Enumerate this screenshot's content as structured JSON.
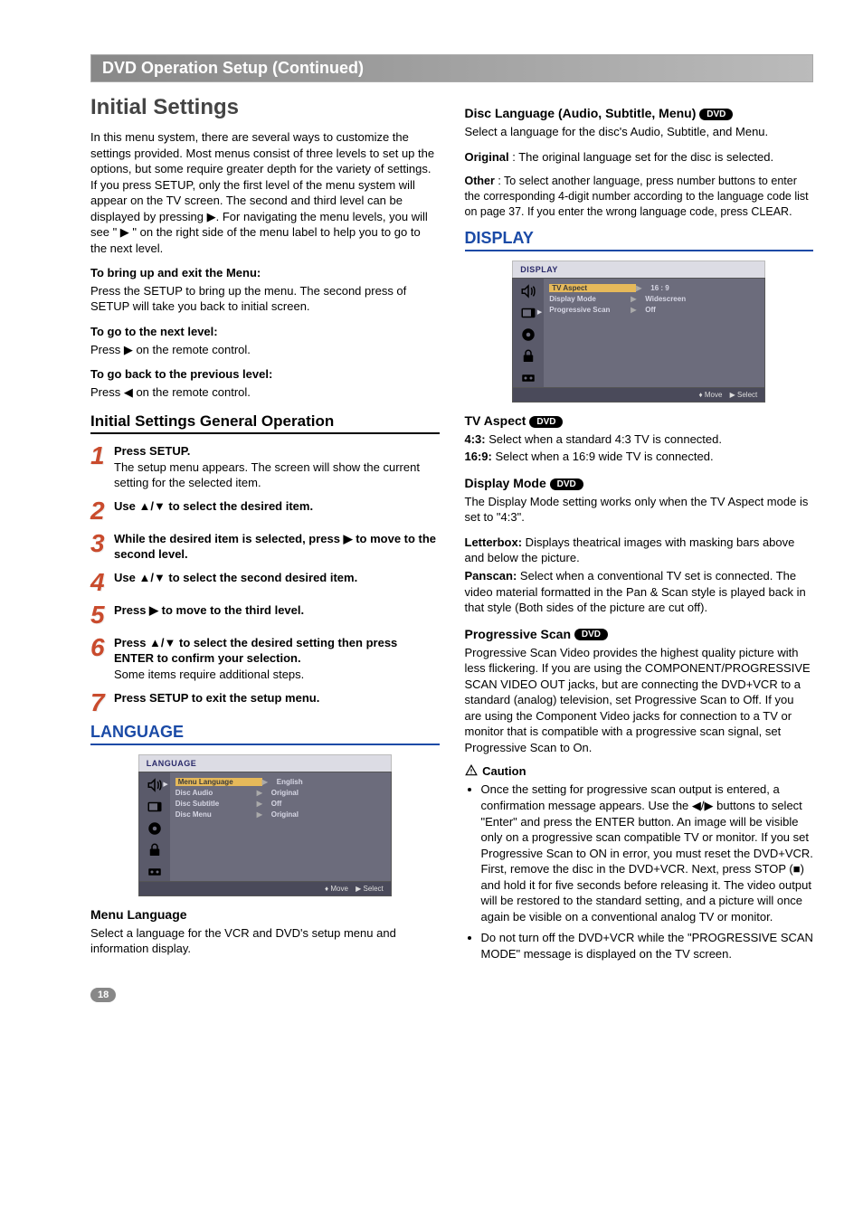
{
  "header": {
    "title": "DVD Operation Setup (Continued)"
  },
  "left": {
    "main_title": "Initial Settings",
    "intro": "In this menu system, there are several ways to customize the settings provided. Most menus consist of three levels to set up the options, but some require greater depth for the variety of settings. If you press SETUP, only the first level of the menu system will appear on the TV screen. The second and third level can be displayed by pressing ▶. For navigating the menu levels, you will see \" ▶ \" on the right side of the menu label to help you to go to the next level.",
    "bring_title": "To bring up and exit the Menu:",
    "bring_body": "Press the SETUP to bring up the menu. The second press of SETUP will take you back to initial screen.",
    "next_title": "To go to the next level:",
    "next_body": "Press ▶ on the remote control.",
    "prev_title": "To go back to the previous level:",
    "prev_body": "Press ◀ on the remote control.",
    "general_title": "Initial Settings General Operation",
    "steps": [
      {
        "n": "1",
        "bold": "Press SETUP.",
        "rest": "The setup menu appears. The screen will show the current setting for the selected item."
      },
      {
        "n": "2",
        "bold": "Use ▲/▼ to select the desired item.",
        "rest": ""
      },
      {
        "n": "3",
        "bold": "While the desired item is selected, press ▶ to move to the second level.",
        "rest": ""
      },
      {
        "n": "4",
        "bold": "Use ▲/▼ to select the second desired item.",
        "rest": ""
      },
      {
        "n": "5",
        "bold": "Press ▶ to move to the third level.",
        "rest": ""
      },
      {
        "n": "6",
        "bold": "Press ▲/▼ to select the desired setting then press ENTER to confirm your selection.",
        "rest": "Some items require additional steps."
      },
      {
        "n": "7",
        "bold": "Press SETUP to exit the setup menu.",
        "rest": ""
      }
    ],
    "language_heading": "LANGUAGE",
    "osd_lang": {
      "title": "LANGUAGE",
      "rows": [
        {
          "label": "Menu Language",
          "value": "English",
          "hl": true
        },
        {
          "label": "Disc Audio",
          "value": "Original",
          "hl": false
        },
        {
          "label": "Disc Subtitle",
          "value": "Off",
          "hl": false
        },
        {
          "label": "Disc Menu",
          "value": "Original",
          "hl": false
        }
      ],
      "footer_move": "Move",
      "footer_select": "Select"
    },
    "menu_lang_title": "Menu Language",
    "menu_lang_body": "Select a language for the VCR and DVD's setup menu and information display."
  },
  "right": {
    "disclang_title": "Disc Language (Audio, Subtitle, Menu)",
    "disclang_intro": "Select a language for the disc's Audio, Subtitle, and Menu.",
    "disclang_original_label": "Original",
    "disclang_original_val": " : The original language set for the disc is selected.",
    "disclang_other_label": "Other",
    "disclang_other_val": " : To select another language, press number buttons to enter the corresponding 4-digit number according to the language code list on page 37. If you enter the wrong language code, press CLEAR.",
    "display_heading": "DISPLAY",
    "osd_display": {
      "title": "DISPLAY",
      "rows": [
        {
          "label": "TV Aspect",
          "value": "16  :  9",
          "hl": true
        },
        {
          "label": "Display Mode",
          "value": "Widescreen",
          "hl": false
        },
        {
          "label": "Progressive Scan",
          "value": "Off",
          "hl": false
        }
      ],
      "footer_move": "Move",
      "footer_select": "Select"
    },
    "tvaspect_title": "TV Aspect",
    "tvaspect_43_label": "4:3:",
    "tvaspect_43_body": " Select when a standard 4:3 TV is connected.",
    "tvaspect_169_label": "16:9:",
    "tvaspect_169_body": " Select when a 16:9 wide TV is connected.",
    "dispmode_title": "Display Mode",
    "dispmode_intro": "The Display Mode setting works only when the TV Aspect mode is set to \"4:3\".",
    "dispmode_lb_label": "Letterbox:",
    "dispmode_lb_body": " Displays theatrical images with masking bars above and below the picture.",
    "dispmode_ps_label": "Panscan:",
    "dispmode_ps_body": " Select when a conventional TV set is connected. The video material formatted in the Pan & Scan style is played back in that style (Both sides of the picture are cut off).",
    "progscan_title": "Progressive Scan",
    "progscan_body": "Progressive Scan Video provides the highest quality picture with less flickering. If you are using the COMPONENT/PROGRESSIVE SCAN VIDEO OUT jacks, but are connecting the DVD+VCR to a standard (analog) television, set Progressive Scan to Off. If you are using the Component Video jacks for connection to a TV or monitor that is compatible with a progressive scan signal, set Progressive Scan to On.",
    "caution_label": "Caution",
    "caution_items": [
      "Once the setting for progressive scan output is entered, a confirmation message appears. Use the ◀/▶ buttons to select \"Enter\" and press the ENTER button. An image will be visible only on a progressive scan compatible TV or monitor. If you set Progressive Scan to ON in error, you must reset the DVD+VCR. First, remove the disc in the DVD+VCR. Next, press STOP (■) and hold it for five seconds before releasing it. The video output will be restored to the standard setting, and a picture will once again be visible on a conventional analog TV or monitor.",
      "Do not turn off the DVD+VCR while the \"PROGRESSIVE SCAN MODE\" message is displayed on the TV screen."
    ]
  },
  "badge": {
    "dvd": "DVD"
  },
  "page_number": "18",
  "icons": {
    "speaker": "speaker-icon",
    "tv": "tv-icon",
    "disc": "disc-icon",
    "lock": "lock-icon",
    "vcr": "vcr-icon",
    "caution": "caution-icon"
  }
}
